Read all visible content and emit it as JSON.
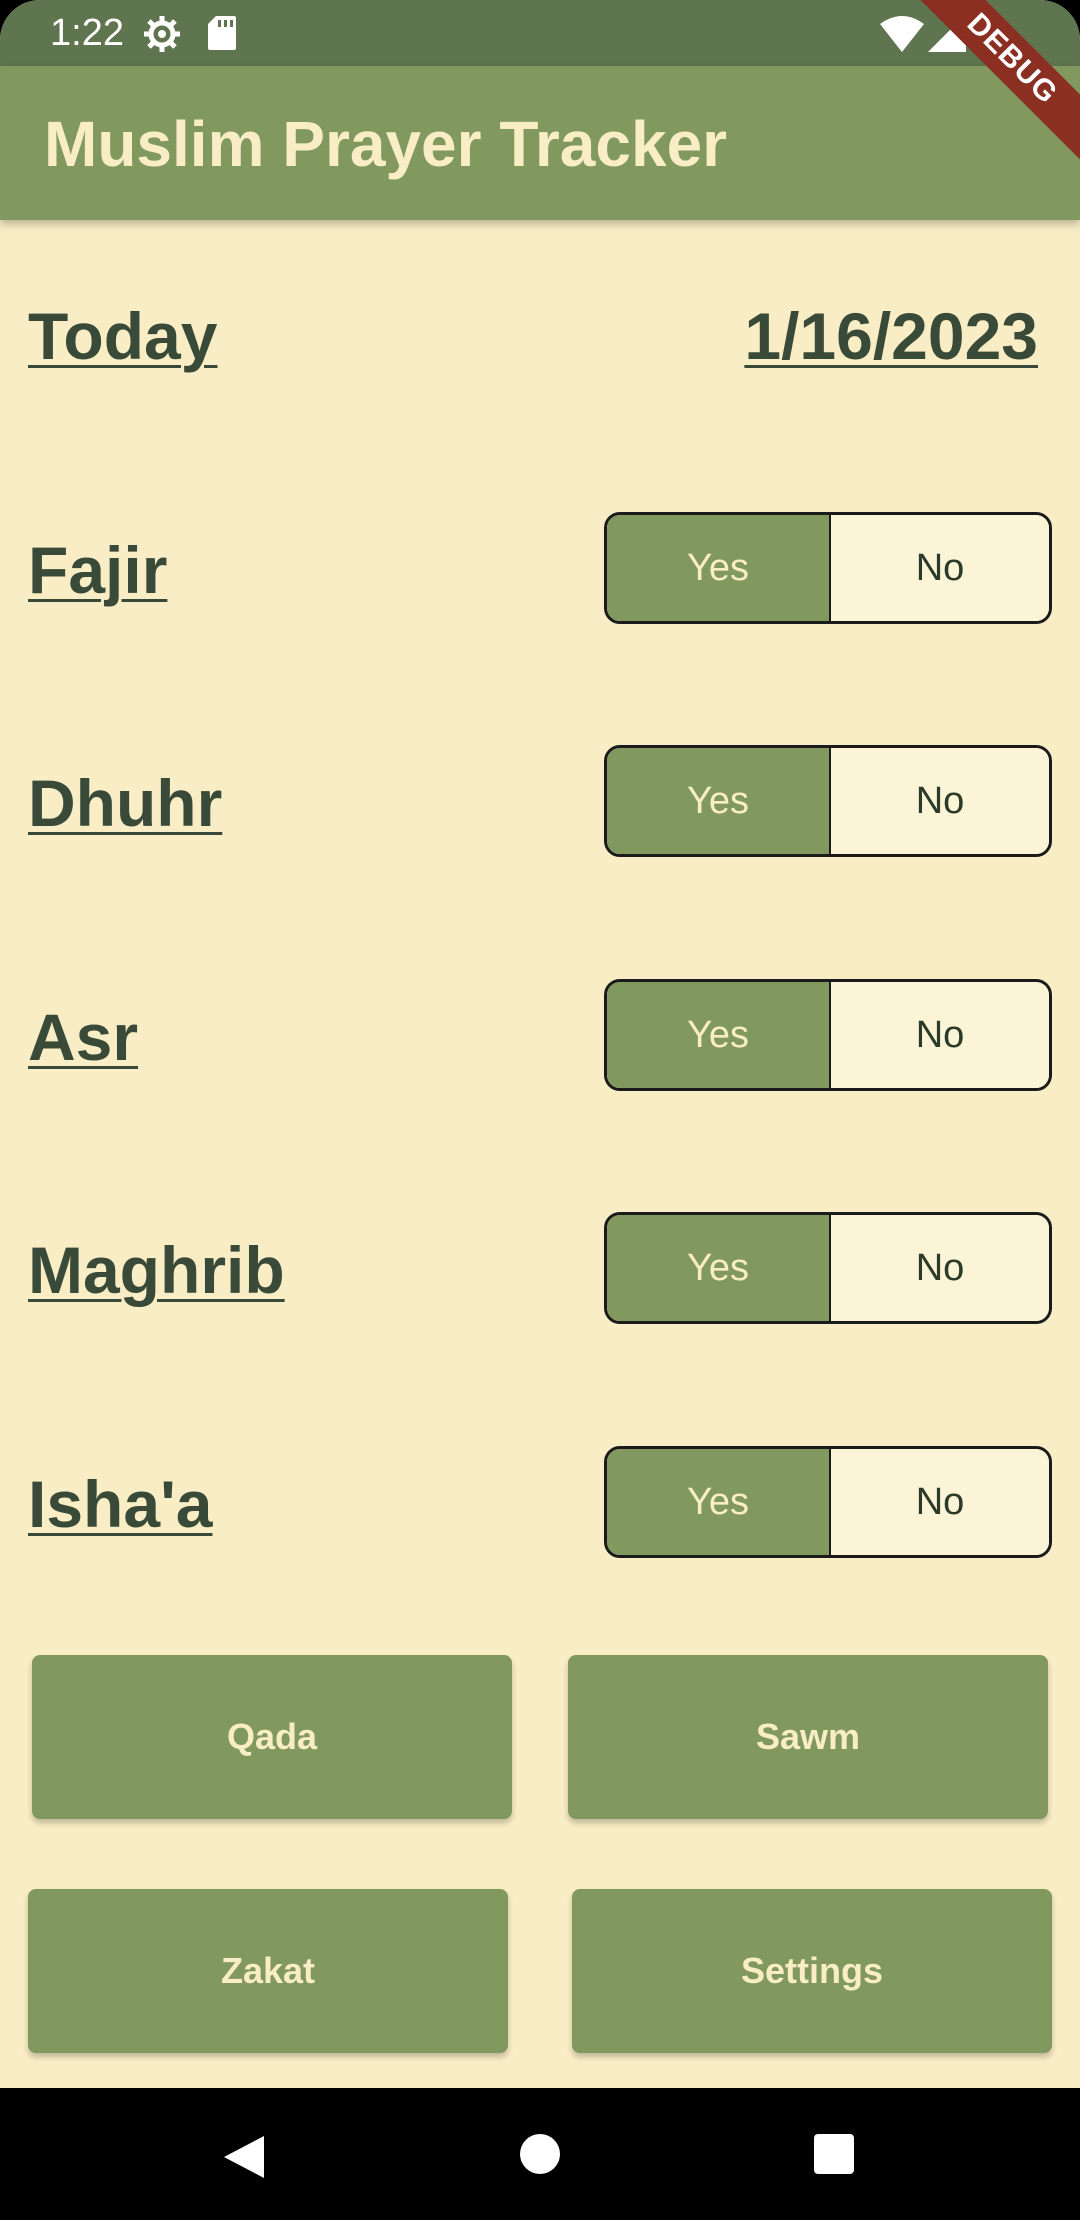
{
  "status_bar": {
    "time": "1:22"
  },
  "app_bar": {
    "title": "Muslim Prayer Tracker",
    "debug_label": "DEBUG"
  },
  "today": {
    "label": "Today",
    "date": "1/16/2023"
  },
  "prayers": [
    {
      "name": "Fajir",
      "yes": "Yes",
      "no": "No",
      "selected": "Yes"
    },
    {
      "name": "Dhuhr",
      "yes": "Yes",
      "no": "No",
      "selected": "Yes"
    },
    {
      "name": "Asr",
      "yes": "Yes",
      "no": "No",
      "selected": "Yes"
    },
    {
      "name": "Maghrib",
      "yes": "Yes",
      "no": "No",
      "selected": "Yes"
    },
    {
      "name": "Isha'a",
      "yes": "Yes",
      "no": "No",
      "selected": "Yes"
    }
  ],
  "buttons": {
    "qada": "Qada",
    "sawm": "Sawm",
    "zakat": "Zakat",
    "settings": "Settings"
  },
  "colors": {
    "background": "#f8edc5",
    "accent": "#81985f",
    "status_bar": "#5f7550",
    "heading_text": "#3a4a38",
    "debug_banner": "#8b2f22"
  },
  "icons": {
    "status": [
      "gear-icon",
      "sd-card-icon",
      "wifi-icon",
      "signal-icon",
      "battery-icon"
    ],
    "nav": [
      "back-icon",
      "home-icon",
      "recents-icon"
    ]
  }
}
